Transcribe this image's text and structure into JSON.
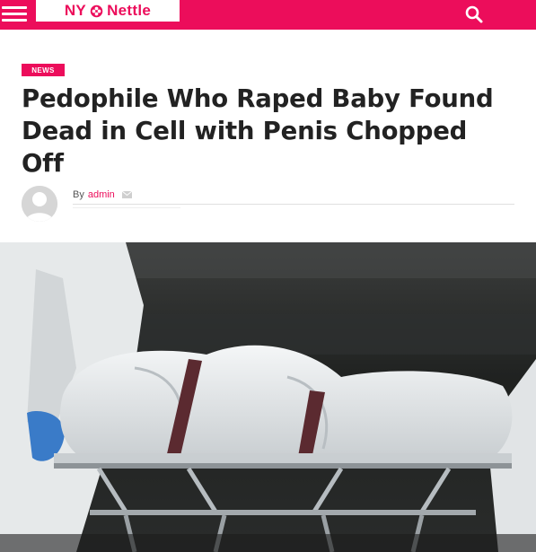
{
  "header": {
    "logo_text": "NY",
    "logo_text2": "Nettle",
    "menu_icon": "hamburger-menu-icon",
    "search_icon": "search-icon",
    "brand_color": "#ec0d5b"
  },
  "article": {
    "category": "NEWS",
    "title": "Pedophile Who Raped Baby Found Dead in Cell with Penis Chopped Off",
    "byline_prefix": "By",
    "author": "admin",
    "mail_icon": "envelope-icon"
  },
  "image": {
    "description_icon": "featured-photo"
  }
}
